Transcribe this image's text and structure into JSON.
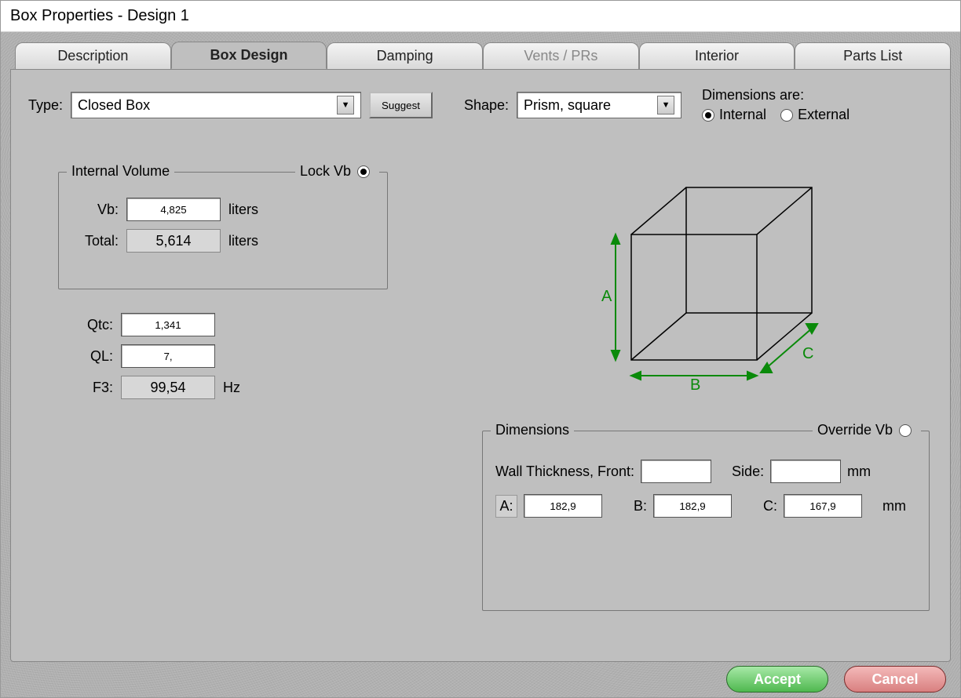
{
  "window": {
    "title": "Box Properties - Design 1"
  },
  "tabs": [
    {
      "label": "Description",
      "active": false,
      "enabled": true
    },
    {
      "label": "Box Design",
      "active": true,
      "enabled": true
    },
    {
      "label": "Damping",
      "active": false,
      "enabled": true
    },
    {
      "label": "Vents / PRs",
      "active": false,
      "enabled": false
    },
    {
      "label": "Interior",
      "active": false,
      "enabled": true
    },
    {
      "label": "Parts List",
      "active": false,
      "enabled": true
    }
  ],
  "row1": {
    "type_label": "Type:",
    "type_value": "Closed Box",
    "suggest_label": "Suggest",
    "shape_label": "Shape:",
    "shape_value": "Prism, square",
    "dims_are_label": "Dimensions are:",
    "dims_internal": "Internal",
    "dims_external": "External",
    "dims_selected": "Internal"
  },
  "volume": {
    "legend": "Internal Volume",
    "lock_label": "Lock Vb",
    "lock_checked": true,
    "vb_label": "Vb:",
    "vb_value": "4,825",
    "vb_unit": "liters",
    "total_label": "Total:",
    "total_value": "5,614",
    "total_unit": "liters"
  },
  "params": {
    "qtc_label": "Qtc:",
    "qtc_value": "1,341",
    "ql_label": "QL:",
    "ql_value": "7,",
    "f3_label": "F3:",
    "f3_value": "99,54",
    "f3_unit": "Hz"
  },
  "diagram": {
    "a_label": "A",
    "b_label": "B",
    "c_label": "C"
  },
  "dims": {
    "legend": "Dimensions",
    "override_label": "Override Vb",
    "override_checked": false,
    "wall_label": "Wall Thickness, Front:",
    "wall_front_value": "",
    "side_label": "Side:",
    "wall_side_value": "",
    "wall_unit": "mm",
    "a_label": "A:",
    "a_value": "182,9",
    "b_label": "B:",
    "b_value": "182,9",
    "c_label": "C:",
    "c_value": "167,9",
    "abc_unit": "mm"
  },
  "buttons": {
    "accept": "Accept",
    "cancel": "Cancel"
  }
}
